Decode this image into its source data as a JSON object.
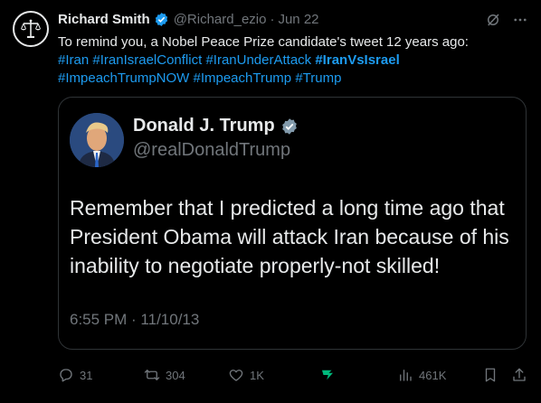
{
  "tweet": {
    "author_name": "Richard Smith",
    "author_handle": "@Richard_ezio",
    "separator": "·",
    "date": "Jun 22",
    "text": "To remind you, a Nobel Peace Prize candidate's tweet 12 years ago:",
    "hashtags": [
      {
        "text": "#Iran",
        "bold": false
      },
      {
        "text": "#IranIsraelConflict",
        "bold": false
      },
      {
        "text": "#IranUnderAttack",
        "bold": false
      },
      {
        "text": "#IranVsIsrael",
        "bold": true
      },
      {
        "text": "#ImpeachTrumpNOW",
        "bold": false
      },
      {
        "text": "#ImpeachTrump",
        "bold": false
      },
      {
        "text": "#Trump",
        "bold": false
      }
    ]
  },
  "quote": {
    "name": "Donald J. Trump",
    "handle": "@realDonaldTrump",
    "body": "Remember that I predicted a long time ago that President Obama will attack Iran because of his inability to negotiate properly-not skilled!",
    "timestamp": "6:55 PM · 11/10/13"
  },
  "actions": {
    "replies": "31",
    "reposts": "304",
    "likes": "1K",
    "views": "461K"
  },
  "colors": {
    "background": "#000000",
    "text": "#e7e9ea",
    "muted": "#71767b",
    "link": "#1d9bf0",
    "verified": "#1d9bf0",
    "grok": "#00ba7c"
  },
  "icons": [
    "scales-logo-icon",
    "verified-badge-icon",
    "grok-slash-icon",
    "more-icon",
    "reply-icon",
    "retweet-icon",
    "like-icon",
    "grok-icon",
    "views-icon",
    "bookmark-icon",
    "share-icon"
  ]
}
